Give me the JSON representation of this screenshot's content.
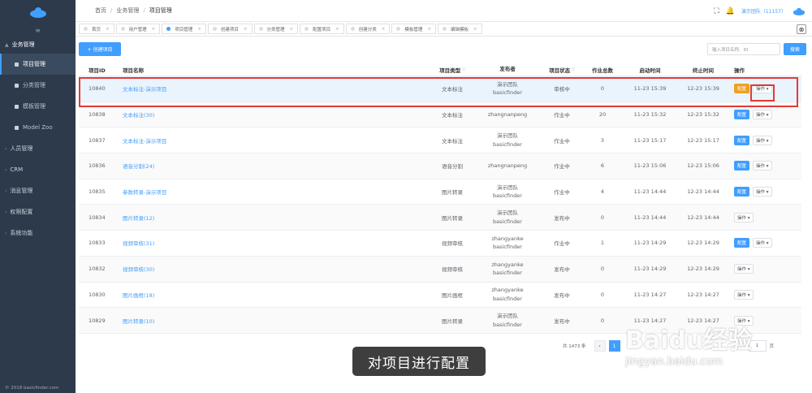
{
  "sidebar": {
    "toggle_icon": "menu-icon",
    "section_label": "业务管理",
    "sub_items": [
      {
        "label": "项目管理",
        "active": true
      },
      {
        "label": "分类管理",
        "active": false
      },
      {
        "label": "模板管理",
        "active": false
      },
      {
        "label": "Model Zoo",
        "active": false
      }
    ],
    "menu_items": [
      "人员管理",
      "CRM",
      "消息管理",
      "权限配置",
      "系统功能"
    ],
    "footer": "© 2018 basicfinder.com"
  },
  "header": {
    "breadcrumb": [
      "首页",
      "业务管理",
      "项目管理"
    ],
    "user_label": "演示团队（11157）"
  },
  "tabs": [
    "首页",
    "用户管理",
    "项目管理",
    "创建项目",
    "分类管理",
    "配置项目",
    "创建分类",
    "模板管理",
    "编辑模板"
  ],
  "active_tab": "项目管理",
  "toolbar": {
    "create_label": "+ 创建项目",
    "search_placeholder": "输入项目名称、ID",
    "search_label": "搜索"
  },
  "table": {
    "headers": {
      "id": "项目ID",
      "name": "项目名称",
      "type": "项目类型",
      "publisher": "发布者",
      "status": "项目状态",
      "total": "作业总数",
      "start": "启动时间",
      "end": "终止时间",
      "op": "操作"
    },
    "config_label": "配置",
    "op_label": "操作 ▾",
    "rows": [
      {
        "id": "10840",
        "name": "文本标注-演示项目",
        "type": "文本标注",
        "pub1": "演示团队",
        "pub2": "basicfinder",
        "status": "审核中",
        "total": "0",
        "start": "11-23 15:39",
        "end": "12-23 15:39",
        "has_config": true
      },
      {
        "id": "10838",
        "name": "文本标注(30)",
        "type": "文本标注",
        "pub1": "zhangnanpeng",
        "pub2": "",
        "status": "作业中",
        "total": "20",
        "start": "11-23 15:32",
        "end": "12-23 15:32",
        "has_config": true
      },
      {
        "id": "10837",
        "name": "文本标注-演示项目",
        "type": "文本标注",
        "pub1": "演示团队",
        "pub2": "basicfinder",
        "status": "作业中",
        "total": "3",
        "start": "11-23 15:17",
        "end": "12-23 15:17",
        "has_config": true
      },
      {
        "id": "10836",
        "name": "语音分割(24)",
        "type": "语音分割",
        "pub1": "zhangnanpeng",
        "pub2": "",
        "status": "作业中",
        "total": "6",
        "start": "11-23 15:06",
        "end": "12-23 15:06",
        "has_config": true
      },
      {
        "id": "10835",
        "name": "参数转录-演示项目",
        "type": "图片转录",
        "pub1": "演示团队",
        "pub2": "basicfinder",
        "status": "作业中",
        "total": "4",
        "start": "11-23 14:44",
        "end": "12-23 14:44",
        "has_config": true
      },
      {
        "id": "10834",
        "name": "图片转录(12)",
        "type": "图片转录",
        "pub1": "演示团队",
        "pub2": "basicfinder",
        "status": "发布中",
        "total": "0",
        "start": "11-23 14:44",
        "end": "12-23 14:44",
        "has_config": false
      },
      {
        "id": "10833",
        "name": "视频审核(31)",
        "type": "视频审核",
        "pub1": "zhangyanke",
        "pub2": "basicfinder",
        "status": "作业中",
        "total": "1",
        "start": "11-23 14:29",
        "end": "12-23 14:29",
        "has_config": true
      },
      {
        "id": "10832",
        "name": "视频审核(30)",
        "type": "视频审核",
        "pub1": "zhangyanke",
        "pub2": "basicfinder",
        "status": "发布中",
        "total": "0",
        "start": "11-23 14:29",
        "end": "12-23 14:29",
        "has_config": false
      },
      {
        "id": "10830",
        "name": "图片画框(18)",
        "type": "图片画框",
        "pub1": "zhangyanke",
        "pub2": "basicfinder",
        "status": "发布中",
        "total": "0",
        "start": "11-23 14:27",
        "end": "12-23 14:27",
        "has_config": false
      },
      {
        "id": "10829",
        "name": "图片转录(10)",
        "type": "图片转录",
        "pub1": "演示团队",
        "pub2": "basicfinder",
        "status": "发布中",
        "total": "0",
        "start": "11-23 14:27",
        "end": "12-23 14:27",
        "has_config": false
      }
    ]
  },
  "pagination": {
    "total": "共 1473 条",
    "current": "1",
    "goto": "1",
    "page_label": "页",
    "prev": "‹"
  },
  "caption": "对项目进行配置",
  "watermark": {
    "logo": "Baidu经验",
    "url": "jingyan.baidu.com"
  }
}
